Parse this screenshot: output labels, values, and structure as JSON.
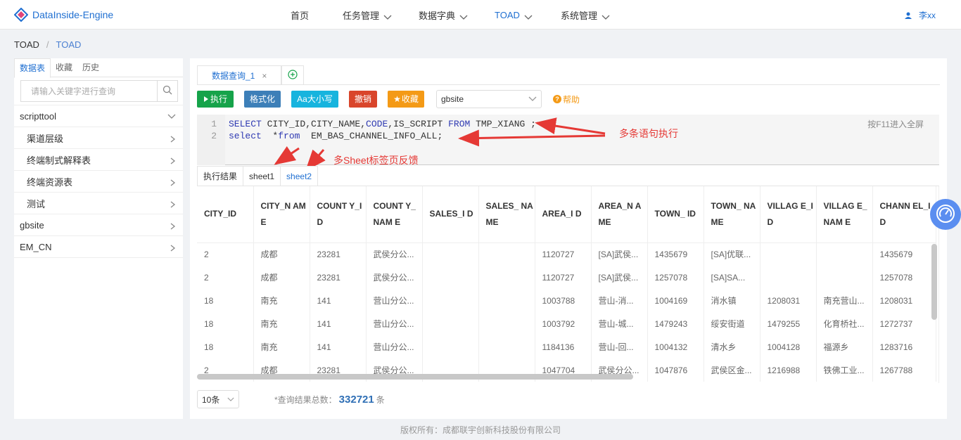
{
  "app": {
    "logo_text": "DataInside-Engine"
  },
  "nav": {
    "items": [
      {
        "label": "首页",
        "has_dropdown": false
      },
      {
        "label": "任务管理",
        "has_dropdown": true
      },
      {
        "label": "数据字典",
        "has_dropdown": true
      },
      {
        "label": "TOAD",
        "has_dropdown": true
      },
      {
        "label": "系统管理",
        "has_dropdown": true
      }
    ],
    "user": "李xx"
  },
  "breadcrumb": {
    "root": "TOAD",
    "separator": "/",
    "current": "TOAD"
  },
  "sidebar": {
    "tabs": [
      "数据表",
      "收藏",
      "历史"
    ],
    "active_tab": "数据表",
    "search_placeholder": "请输入关键字进行查询",
    "tree": [
      {
        "label": "scripttool",
        "expanded": true,
        "level": 0
      },
      {
        "label": "渠道层级",
        "level": 1
      },
      {
        "label": "终端制式解释表",
        "level": 1
      },
      {
        "label": "终端资源表",
        "level": 1
      },
      {
        "label": "测试",
        "level": 1
      },
      {
        "label": "gbsite",
        "level": 0
      },
      {
        "label": "EM_CN",
        "level": 0
      }
    ]
  },
  "query_tab": {
    "label": "数据查询_1",
    "close": "×"
  },
  "toolbar": {
    "execute": "执行",
    "format": "格式化",
    "case": "Aa大小写",
    "undo": "撤销",
    "favorite": "收藏",
    "datasource": "gbsite",
    "help": "帮助"
  },
  "editor": {
    "line_numbers": [
      "1",
      "2"
    ],
    "lines": [
      [
        {
          "t": "SELECT",
          "k": true
        },
        {
          "t": " CITY_ID,CITY_NAME,",
          "k": false
        },
        {
          "t": "CODE",
          "k": true
        },
        {
          "t": ",IS_SCRIPT ",
          "k": false
        },
        {
          "t": "FROM",
          "k": true
        },
        {
          "t": " TMP_XIANG ;",
          "k": false
        }
      ],
      [
        {
          "t": "select",
          "k": true
        },
        {
          "t": "  *",
          "k": false
        },
        {
          "t": "from",
          "k": true
        },
        {
          "t": "  EM_BAS_CHANNEL_INFO_ALL;",
          "k": false
        }
      ]
    ],
    "fullscreen_hint": "按F11进入全屏"
  },
  "annotations": {
    "multi_statement": "多条语句执行",
    "multi_sheet": "多Sheet标签页反馈"
  },
  "result_tabs": [
    "执行结果",
    "sheet1",
    "sheet2"
  ],
  "active_result_tab": "sheet2",
  "table": {
    "headers": [
      "CITY_ID",
      "CITY_N AME",
      "COUNT Y_ID",
      "COUNT Y_NAM E",
      "SALES_I D",
      "SALES_ NAME",
      "AREA_I D",
      "AREA_N AME",
      "TOWN_ ID",
      "TOWN_ NAME",
      "VILLAG E_ID",
      "VILLAG E_NAM E",
      "CHANN EL_ID"
    ],
    "rows": [
      [
        "2",
        "成都",
        "23281",
        "武侯分公...",
        "",
        "",
        "1120727",
        "[SA]武侯...",
        "1435679",
        "[SA]优联...",
        "",
        "",
        "1435679"
      ],
      [
        "2",
        "成都",
        "23281",
        "武侯分公...",
        "",
        "",
        "1120727",
        "[SA]武侯...",
        "1257078",
        "[SA]SA...",
        "",
        "",
        "1257078"
      ],
      [
        "18",
        "南充",
        "141",
        "营山分公...",
        "",
        "",
        "1003788",
        "营山-消...",
        "1004169",
        "消水镇",
        "1208031",
        "南充营山...",
        "1208031"
      ],
      [
        "18",
        "南充",
        "141",
        "营山分公...",
        "",
        "",
        "1003792",
        "营山-城...",
        "1479243",
        "绥安街道",
        "1479255",
        "化育桥社...",
        "1272737"
      ],
      [
        "18",
        "南充",
        "141",
        "营山分公...",
        "",
        "",
        "1184136",
        "营山-回...",
        "1004132",
        "清水乡",
        "1004128",
        "福源乡",
        "1283716"
      ],
      [
        "2",
        "成都",
        "23281",
        "武侯分公...",
        "",
        "",
        "1047704",
        "武侯分公...",
        "1047876",
        "武侯区金...",
        "1216988",
        "铁佛工业...",
        "1267788"
      ]
    ]
  },
  "pagination": {
    "page_size": "10条",
    "total_label": "*查询结果总数：",
    "total_value": "332721",
    "total_unit": "条"
  },
  "copyright": "版权所有：成都联宇创新科技股份有限公司",
  "colors": {
    "brand": "#1f6fd1",
    "execute": "#16a34a",
    "format": "#3d7fb8",
    "case": "#17b4de",
    "undo": "#d9452b",
    "favorite": "#f49a16",
    "annotation": "#e53935"
  }
}
